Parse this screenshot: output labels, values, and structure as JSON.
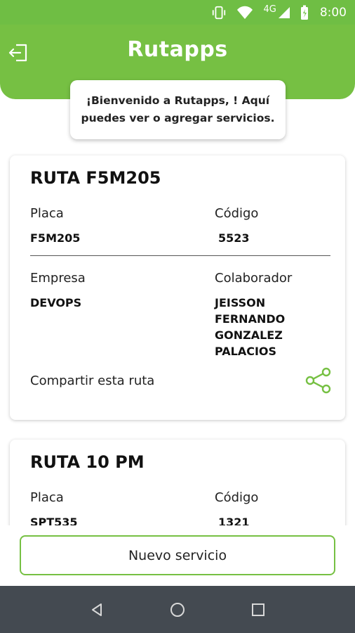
{
  "status_bar": {
    "network": "4G",
    "time": "8:00"
  },
  "header": {
    "logo": "Rutapps"
  },
  "welcome": {
    "message": "¡Bienvenido a Rutapps, ! Aquí puedes ver o agregar servicios."
  },
  "routes": [
    {
      "title": "RUTA F5M205",
      "placa_label": "Placa",
      "placa": "F5M205",
      "codigo_label": "Código",
      "codigo": "5523",
      "empresa_label": "Empresa",
      "empresa": "DEVOPS",
      "colaborador_label": "Colaborador",
      "colaborador_lines": [
        "JEISSON",
        "FERNANDO",
        "GONZALEZ",
        "PALACIOS"
      ],
      "share_label": "Compartir esta ruta"
    },
    {
      "title": "RUTA 10 PM",
      "placa_label": "Placa",
      "placa": "SPT535",
      "codigo_label": "Código",
      "codigo": "1321"
    }
  ],
  "actions": {
    "new_service": "Nuevo servicio"
  },
  "colors": {
    "brand_green": "#76c043",
    "status_green": "#6fbe44",
    "nav_bar": "#444a51"
  }
}
